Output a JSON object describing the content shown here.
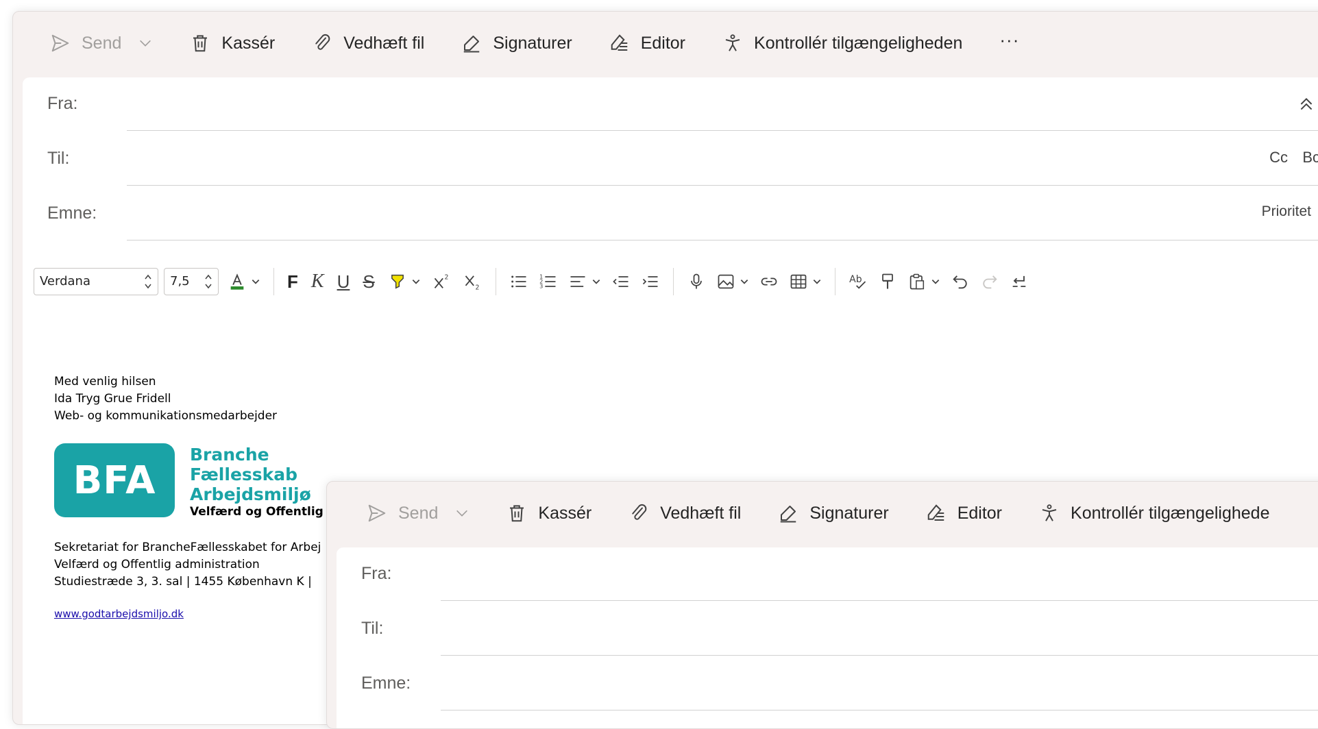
{
  "toolbar": {
    "send": "Send",
    "discard": "Kassér",
    "attach": "Vedhæft fil",
    "signatures": "Signaturer",
    "editor": "Editor",
    "accessibility": "Kontrollér tilgængeligheden",
    "more": "···"
  },
  "toolbar2": {
    "send": "Send",
    "discard": "Kassér",
    "attach": "Vedhæft fil",
    "signatures": "Signaturer",
    "editor": "Editor",
    "accessibility": "Kontrollér tilgængelighede"
  },
  "fields": {
    "from_label": "Fra:",
    "to_label": "Til:",
    "subject_label": "Emne:",
    "cc": "Cc",
    "bcc": "Bcc",
    "priority": "Prioritet"
  },
  "format": {
    "font_name": "Verdana",
    "font_size": "7,5",
    "bold": "F",
    "italic": "K",
    "underline": "U",
    "strike": "S"
  },
  "signature": {
    "greeting": "Med venlig hilsen",
    "name": "Ida Tryg Grue Fridell",
    "title": "Web- og kommunikationsmedarbejder",
    "logo_abbr": "BFA",
    "logo_line1": "Branche",
    "logo_line2": "Fællesskab",
    "logo_line3": "Arbejdsmiljø",
    "logo_sub": "Velfærd og Offentlig adm",
    "org_line1": "Sekretariat for BrancheFællesskabet for Arbej",
    "org_line2": "Velfærd og Offentlig administration",
    "org_line3": "Studiestræde 3, 3. sal | 1455 København K |",
    "website": "www.godtarbejdsmiljo.dk"
  },
  "colors": {
    "accent_teal": "#1aa3a6",
    "toolbar_bg": "#f6f1f0",
    "highlight_yellow": "#f2e200",
    "font_color_green": "#2e8b2e",
    "link_blue": "#1a0dab"
  }
}
